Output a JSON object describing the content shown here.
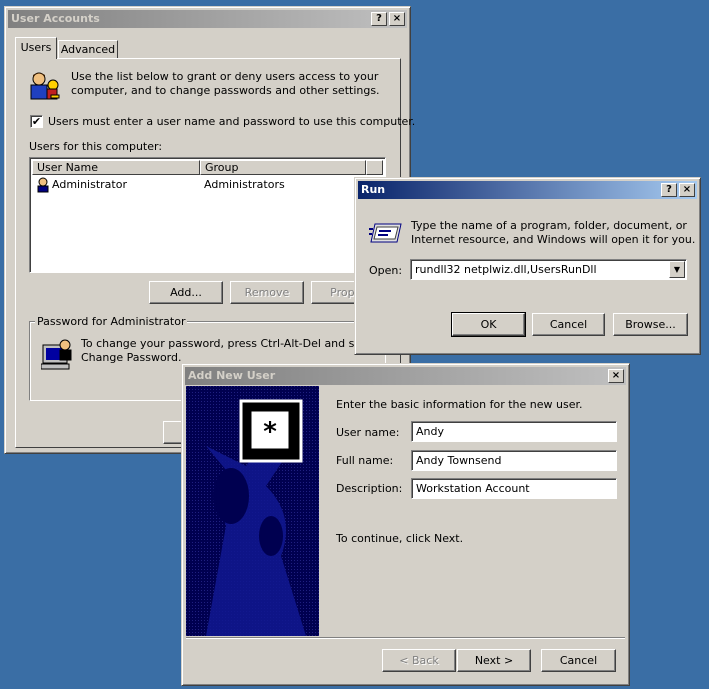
{
  "user_accounts": {
    "title": "User Accounts",
    "tabs": [
      {
        "label": "Users"
      },
      {
        "label": "Advanced"
      }
    ],
    "intro": "Use the list below to grant or deny users access to your computer, and to change passwords and other settings.",
    "intro_line1": "Use the list below to grant or deny users access to your",
    "intro_line2": "computer, and to change passwords and other settings.",
    "checkbox_label": "Users must enter a user name and password to use this computer.",
    "checkbox_checked": true,
    "list_label": "Users for this computer:",
    "columns": [
      "User Name",
      "Group"
    ],
    "rows": [
      {
        "user": "Administrator",
        "group": "Administrators"
      }
    ],
    "add_button": "Add...",
    "remove_button": "Remove",
    "properties_button": "Proper",
    "password_group": "Password for Administrator",
    "password_line1": "To change your password, press Ctrl-Alt-Del and select",
    "password_line2": "Change Password."
  },
  "run": {
    "title": "Run",
    "help": "?",
    "close": "×",
    "desc_line1": "Type the name of a program, folder, document, or",
    "desc_line2": "Internet resource, and Windows will open it for you.",
    "open_label": "Open:",
    "open_value": "rundll32 netplwiz.dll,UsersRunDll",
    "ok": "OK",
    "cancel": "Cancel",
    "browse": "Browse..."
  },
  "add_user": {
    "title": "Add New User",
    "close": "×",
    "intro": "Enter the basic information for the new user.",
    "username_label": "User name:",
    "username_value": "Andy",
    "fullname_label": "Full name:",
    "fullname_value": "Andy Townsend",
    "description_label": "Description:",
    "description_value": "Workstation Account",
    "continue": "To continue, click Next.",
    "back": "< Back",
    "next": "Next >",
    "cancel": "Cancel"
  }
}
